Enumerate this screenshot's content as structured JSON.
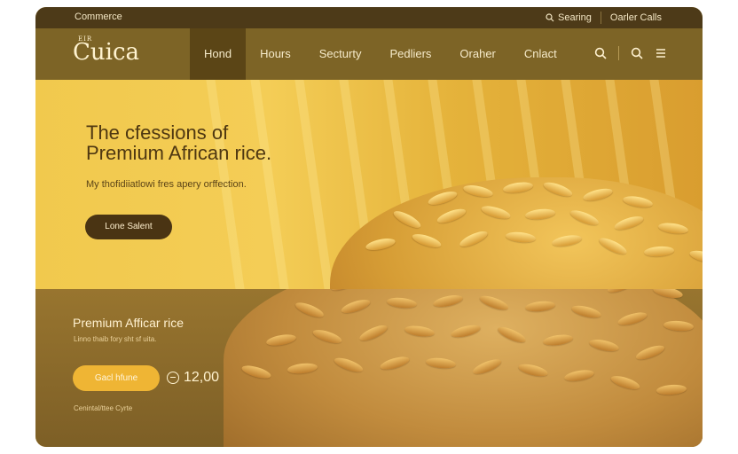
{
  "topbar": {
    "brand": "Commerce",
    "search": "Searing",
    "account": "Oarler Calls"
  },
  "nav": {
    "logo": "Cuica",
    "logo_small": "EIR",
    "items": [
      "Hond",
      "Hours",
      "Secturty",
      "Pedliers",
      "Oraher",
      "Cnlact"
    ],
    "active_index": 0,
    "icons": [
      "search-icon",
      "search-icon",
      "menu-icon"
    ]
  },
  "hero": {
    "title_line1": "The cfessions of",
    "title_line2": "Premium African rice.",
    "subtitle": "My thofidiiatlowi fres apery orffection.",
    "cta": "Lone Salent"
  },
  "product": {
    "title": "Premium Afficar rice",
    "description": "Linno thaib fory sht sf uita.",
    "button": "Gacl hfune",
    "price": "12,00",
    "note": "Cenintal/ttee Cyrte"
  },
  "colors": {
    "dark": "#4d3a18",
    "nav": "#7d6426",
    "gold": "#efb534",
    "cream": "#fff3d0"
  }
}
